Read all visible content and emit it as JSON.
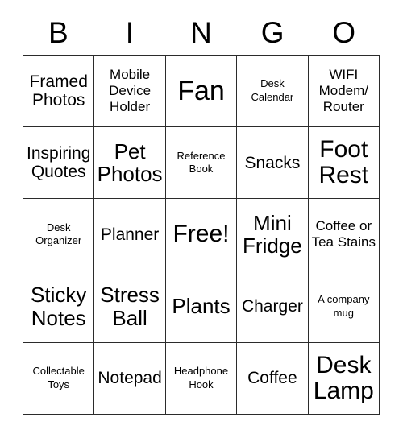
{
  "card": {
    "title": "BINGO",
    "header_letters": [
      "B",
      "I",
      "N",
      "G",
      "O"
    ],
    "free_space_label": "Free!",
    "colors": {
      "background": "#ffffff",
      "text": "#000000",
      "border": "#2b2b2b"
    },
    "grid": {
      "columns": 5,
      "rows": 5,
      "cells": [
        [
          {
            "text": "Framed Photos",
            "size": "sm"
          },
          {
            "text": "Mobile Device Holder",
            "size": "xs"
          },
          {
            "text": "Fan",
            "size": "xl"
          },
          {
            "text": "Desk Calendar",
            "size": "xxs"
          },
          {
            "text": "WIFI Modem/ Router",
            "size": "xs"
          }
        ],
        [
          {
            "text": "Inspiring Quotes",
            "size": "sm"
          },
          {
            "text": "Pet Photos",
            "size": "md"
          },
          {
            "text": "Reference Book",
            "size": "xxs"
          },
          {
            "text": "Snacks",
            "size": "sm"
          },
          {
            "text": "Foot Rest",
            "size": "lg"
          }
        ],
        [
          {
            "text": "Desk Organizer",
            "size": "xxs"
          },
          {
            "text": "Planner",
            "size": "sm"
          },
          {
            "text": "Free!",
            "size": "lg"
          },
          {
            "text": "Mini Fridge",
            "size": "md"
          },
          {
            "text": "Coffee or Tea Stains",
            "size": "xs"
          }
        ],
        [
          {
            "text": "Sticky Notes",
            "size": "md"
          },
          {
            "text": "Stress Ball",
            "size": "md"
          },
          {
            "text": "Plants",
            "size": "md"
          },
          {
            "text": "Charger",
            "size": "sm"
          },
          {
            "text": "A company mug",
            "size": "xxs"
          }
        ],
        [
          {
            "text": "Collectable Toys",
            "size": "xxs"
          },
          {
            "text": "Notepad",
            "size": "sm"
          },
          {
            "text": "Headphone Hook",
            "size": "xxs"
          },
          {
            "text": "Coffee",
            "size": "sm"
          },
          {
            "text": "Desk Lamp",
            "size": "lg"
          }
        ]
      ]
    }
  }
}
